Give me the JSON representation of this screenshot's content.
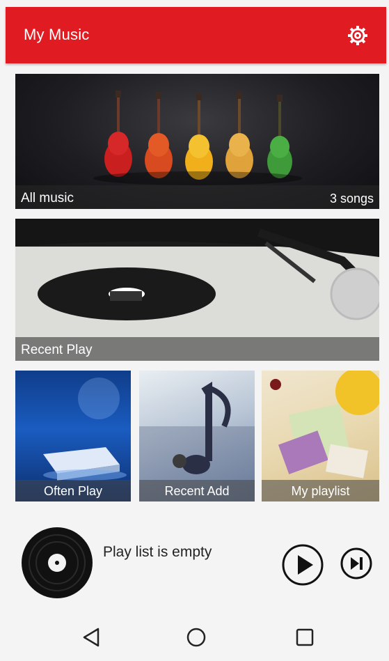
{
  "appbar": {
    "title": "My Music",
    "settings_icon": "gear-icon",
    "color": "#e01b22"
  },
  "cards": {
    "all_music": {
      "label": "All music",
      "count": "3 songs"
    },
    "recent_play": {
      "label": "Recent Play"
    }
  },
  "tiles": [
    {
      "label": "Often Play"
    },
    {
      "label": "Recent Add"
    },
    {
      "label": "My playlist"
    }
  ],
  "player": {
    "status": "Play list is empty",
    "play_icon": "play-icon",
    "next_icon": "skip-next-icon"
  },
  "nav": {
    "back_icon": "back-icon",
    "home_icon": "home-icon",
    "recents_icon": "recents-icon"
  }
}
